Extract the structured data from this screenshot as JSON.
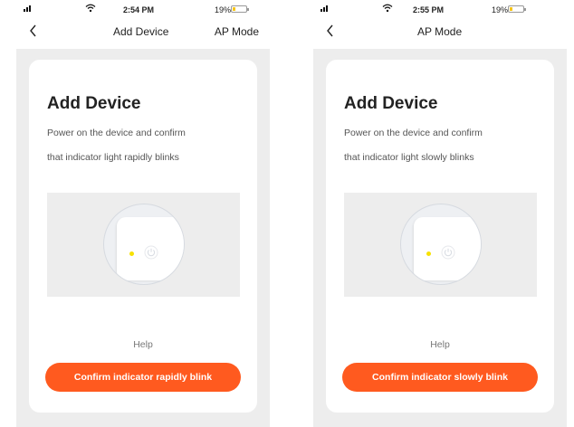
{
  "colors": {
    "accent": "#ff5a1f",
    "battery": "#f6c51b",
    "led": "#f7e100",
    "background_gray": "#ededed",
    "text_dark": "#222222",
    "text_muted": "#777777"
  },
  "screens": [
    {
      "status_bar": {
        "time": "2:54 PM",
        "battery": "19%",
        "battery_level": 0.19,
        "signal_icon": "cell-signal-icon",
        "wifi_icon": "wifi-icon"
      },
      "nav": {
        "back_icon": "chevron-left-icon",
        "title": "Add Device",
        "right_action": "AP Mode"
      },
      "card": {
        "heading": "Add Device",
        "line1": "Power on the device and confirm",
        "line2": "that indicator light rapidly blinks",
        "illustration_icon": "power-icon",
        "led_lit": true,
        "help": "Help",
        "button": "Confirm indicator rapidly blink"
      }
    },
    {
      "status_bar": {
        "time": "2:55 PM",
        "battery": "19%",
        "battery_level": 0.19,
        "signal_icon": "cell-signal-icon",
        "wifi_icon": "wifi-icon"
      },
      "nav": {
        "back_icon": "chevron-left-icon",
        "title": "AP Mode",
        "right_action": ""
      },
      "card": {
        "heading": "Add Device",
        "line1": "Power on the device and confirm",
        "line2": "that indicator light slowly blinks",
        "illustration_icon": "power-icon",
        "led_lit": true,
        "help": "Help",
        "button": "Confirm indicator slowly blink"
      }
    }
  ]
}
